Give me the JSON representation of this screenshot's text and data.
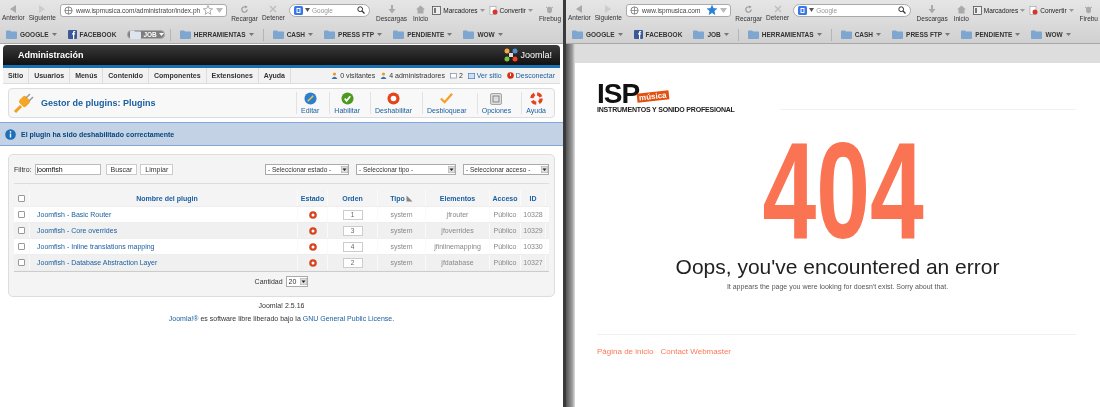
{
  "browsers": [
    {
      "back": "Anterior",
      "forward": "Siguiente",
      "url": "www.ispmusica.com/administrator/index.ph",
      "bookmarked": false,
      "reload": "Recargar",
      "stop": "Detener",
      "search_placeholder": "Google",
      "tools": [
        {
          "label": "Descargas",
          "kind": "download"
        },
        {
          "label": "Inicio",
          "kind": "home"
        },
        {
          "label": "Marcadores",
          "kind": "bookmarks"
        },
        {
          "label": "Convertir",
          "kind": "convert"
        },
        {
          "label": "Firebug",
          "kind": "firebug"
        }
      ],
      "bookmarks": [
        {
          "label": "GOOGLE",
          "kind": "folder",
          "selected": false
        },
        {
          "label": "FACEBOOK",
          "kind": "facebook",
          "selected": false
        },
        {
          "label": "JOB",
          "kind": "folder",
          "selected": true
        },
        {
          "label": "HERRAMIENTAS",
          "kind": "folder",
          "selected": false
        },
        {
          "label": "CASH",
          "kind": "folder",
          "selected": false
        },
        {
          "label": "PRESS FTP",
          "kind": "folder",
          "selected": false
        },
        {
          "label": "PENDIENTE",
          "kind": "folder",
          "selected": false
        },
        {
          "label": "WOW",
          "kind": "folder",
          "selected": false
        }
      ],
      "page": {
        "kind": "admin",
        "title": "Administración",
        "logo": "Joomla!",
        "menu": [
          "Sitio",
          "Usuarios",
          "Menús",
          "Contenido",
          "Componentes",
          "Extensiones",
          "Ayuda"
        ],
        "status": [
          {
            "label": "0 visitantes",
            "kind": "users"
          },
          {
            "label": "4 administradores",
            "kind": "users"
          },
          {
            "label": "2",
            "kind": "messages"
          },
          {
            "label": "Ver sitio",
            "kind": "site"
          },
          {
            "label": "Desconectar",
            "kind": "logout"
          }
        ],
        "heading": "Gestor de plugins: Plugins",
        "actions": [
          {
            "label": "Editar",
            "kind": "edit"
          },
          {
            "label": "Habilitar",
            "kind": "enable"
          },
          {
            "label": "Deshabilitar",
            "kind": "disable"
          },
          {
            "label": "Desbloquear",
            "kind": "unlock"
          },
          {
            "label": "Opciones",
            "kind": "options"
          },
          {
            "label": "Ayuda",
            "kind": "help"
          }
        ],
        "message": "El plugin ha sido deshabilitado correctamente",
        "filter": {
          "label": "Filtro:",
          "value": "joomfish",
          "buttons": [
            "Buscar",
            "Limpiar"
          ],
          "selects": [
            "- Seleccionar estado -",
            "- Seleccionar tipo -",
            "- Seleccionar acceso -"
          ]
        },
        "select_all_checked": false,
        "columns": [
          "Nombre del plugin",
          "Estado",
          "Orden",
          "Tipo",
          "Elementos",
          "Acceso",
          "ID"
        ],
        "rows": [
          {
            "checked": false,
            "name": "Joomfish - Basic Router",
            "enabled": false,
            "order": "1",
            "type": "system",
            "element": "jfrouter",
            "access": "Público",
            "id": "10328"
          },
          {
            "checked": false,
            "name": "Joomfish - Core overrides",
            "enabled": false,
            "order": "3",
            "type": "system",
            "element": "jfoverrides",
            "access": "Público",
            "id": "10329"
          },
          {
            "checked": false,
            "name": "Joomfish - Inline translations mapping",
            "enabled": false,
            "order": "4",
            "type": "system",
            "element": "jfinlinemapping",
            "access": "Público",
            "id": "10330"
          },
          {
            "checked": false,
            "name": "Joomfish - Database Abstraction Layer",
            "enabled": false,
            "order": "2",
            "type": "system",
            "element": "jfdatabase",
            "access": "Público",
            "id": "10327"
          }
        ],
        "limit_label": "Cantidad",
        "limit": "20",
        "version": "Joomla! 2.5.16",
        "license": {
          "link": "Joomla!®",
          "text": " es software libre liberado bajo la ",
          "link2": "GNU General Public License",
          "end": "."
        }
      }
    },
    {
      "back": "Anterior",
      "forward": "Siguiente",
      "url": "www.ispmusica.com",
      "bookmarked": true,
      "reload": "Recargar",
      "stop": "Detener",
      "search_placeholder": "Google",
      "tools": [
        {
          "label": "Descargas",
          "kind": "download"
        },
        {
          "label": "Inicio",
          "kind": "home"
        },
        {
          "label": "Marcadores",
          "kind": "bookmarks"
        },
        {
          "label": "Convertir",
          "kind": "convert"
        },
        {
          "label": "Firebu",
          "kind": "firebug"
        }
      ],
      "bookmarks": [
        {
          "label": "GOOGLE",
          "kind": "folder",
          "selected": false
        },
        {
          "label": "FACEBOOK",
          "kind": "facebook",
          "selected": false
        },
        {
          "label": "JOB",
          "kind": "folder",
          "selected": false
        },
        {
          "label": "HERRAMIENTAS",
          "kind": "folder",
          "selected": false
        },
        {
          "label": "CASH",
          "kind": "folder",
          "selected": false
        },
        {
          "label": "PRESS FTP",
          "kind": "folder",
          "selected": false
        },
        {
          "label": "PENDIENTE",
          "kind": "folder",
          "selected": false
        },
        {
          "label": "WOW",
          "kind": "folder",
          "selected": false
        }
      ],
      "page": {
        "kind": "error",
        "logo": "ISP",
        "logo_badge": "música",
        "tagline": "INSTRUMENTOS Y SONIDO PROFESIONAL",
        "code": "404",
        "heading": "Oops, you've encountered an error",
        "text": "It appears the page you were looking for doesn't exist. Sorry about that.",
        "links": [
          "Página de inicio",
          "Contact Webmaster"
        ]
      }
    }
  ]
}
